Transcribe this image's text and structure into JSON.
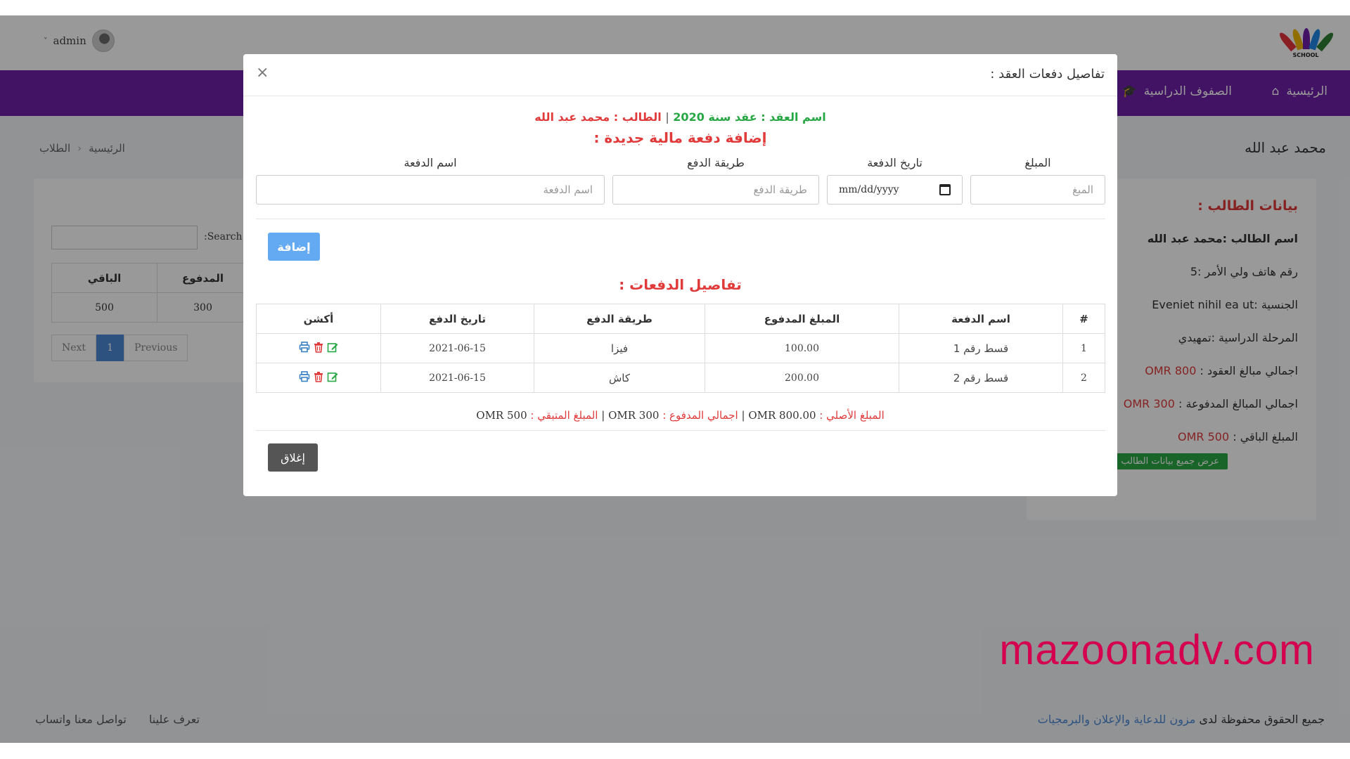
{
  "topbar": {
    "user_name": "admin",
    "chevron_glyph": "˅",
    "logo_text": "SCHOOL"
  },
  "nav": {
    "home_label": "الرئيسية",
    "classes_label": "الصفوف الدراسية",
    "home_icon": "⌂",
    "classes_icon": "🎓"
  },
  "page": {
    "title": "محمد عبد الله",
    "breadcrumb": [
      "الرئيسية",
      "الطلاب"
    ],
    "breadcrumb_sep": "›"
  },
  "left_card": {
    "search_label": ":Search",
    "columns": [
      "الباقي",
      "المدفوع"
    ],
    "row": [
      "500",
      "300"
    ],
    "pager": {
      "next": "Next",
      "page": "1",
      "previous": "Previous"
    }
  },
  "student_card": {
    "heading": "بيانات الطالب :",
    "name": "اسم الطالب :محمد عبد الله",
    "guardian_phone": "رقم هاتف ولي الأمر :5",
    "nationality": "الجنسية :Eveniet nihil ea ut",
    "stage": "المرحلة الدراسية :تمهيدي",
    "contracts_total_label": "اجمالي مبالغ العقود :",
    "contracts_total_value": "OMR 800",
    "paid_total_label": "اجمالي المبالغ المدفوعة :",
    "paid_total_value": "OMR 300",
    "remaining_label": "المبلغ الباقي :",
    "remaining_value": "OMR 500",
    "show_all_button": "عرض جميع بيانات الطالب"
  },
  "footer": {
    "rights_prefix": "جميع الحقوق محفوظة لدى",
    "rights_link": "مزون للدعاية والإعلان والبرمجيات",
    "about": "تعرف علينا",
    "whatsapp": "تواصل معنا واتساب"
  },
  "watermark": "mazoonadv.com",
  "modal": {
    "title": "تفاصيل دفعات العقد :",
    "close_x": "×",
    "contract_label": "اسم العقد : عقد سنة 2020",
    "separator": "|",
    "student_label": "الطالب : محمد عبد الله",
    "add_title": "إضافة دفعة مالية جديدة :",
    "form": {
      "amount_label": "المبلغ",
      "amount_placeholder": "المبغ",
      "date_label": "تاريخ الدفعة",
      "date_placeholder": "mm/dd/yyyy",
      "method_label": "طريقة الدفع",
      "method_placeholder": "طريقة الدفع",
      "name_label": "اسم الدفعة",
      "name_placeholder": "اسم الدفعة"
    },
    "add_button": "إضافة",
    "details_title": "تفاصيل الدفعات :",
    "table": {
      "headers": [
        "#",
        "اسم الدفعة",
        "المبلغ المدفوع",
        "طريقة الدفع",
        "تاريخ الدفع",
        "أكشن"
      ],
      "rows": [
        [
          "1",
          "قسط رقم 1",
          "100.00",
          "فيزا",
          "2021-06-15"
        ],
        [
          "2",
          "قسط رقم 2",
          "200.00",
          "كاش",
          "2021-06-15"
        ]
      ]
    },
    "summary": {
      "original_label": "المبلغ الأصلي :",
      "original_value": "OMR 800.00",
      "paid_label": "اجمالي المدفوع :",
      "paid_value": "OMR 300",
      "remaining_label": "المبلغ المتبقي :",
      "remaining_value": "OMR 500",
      "sep": "|"
    },
    "close_button": "إغلاق"
  },
  "colors": {
    "nav_purple": "#6f1fa8",
    "accent_red": "#e03a3a",
    "accent_green": "#28a745",
    "button_blue": "#64aaf2",
    "watermark": "#d4004f"
  }
}
